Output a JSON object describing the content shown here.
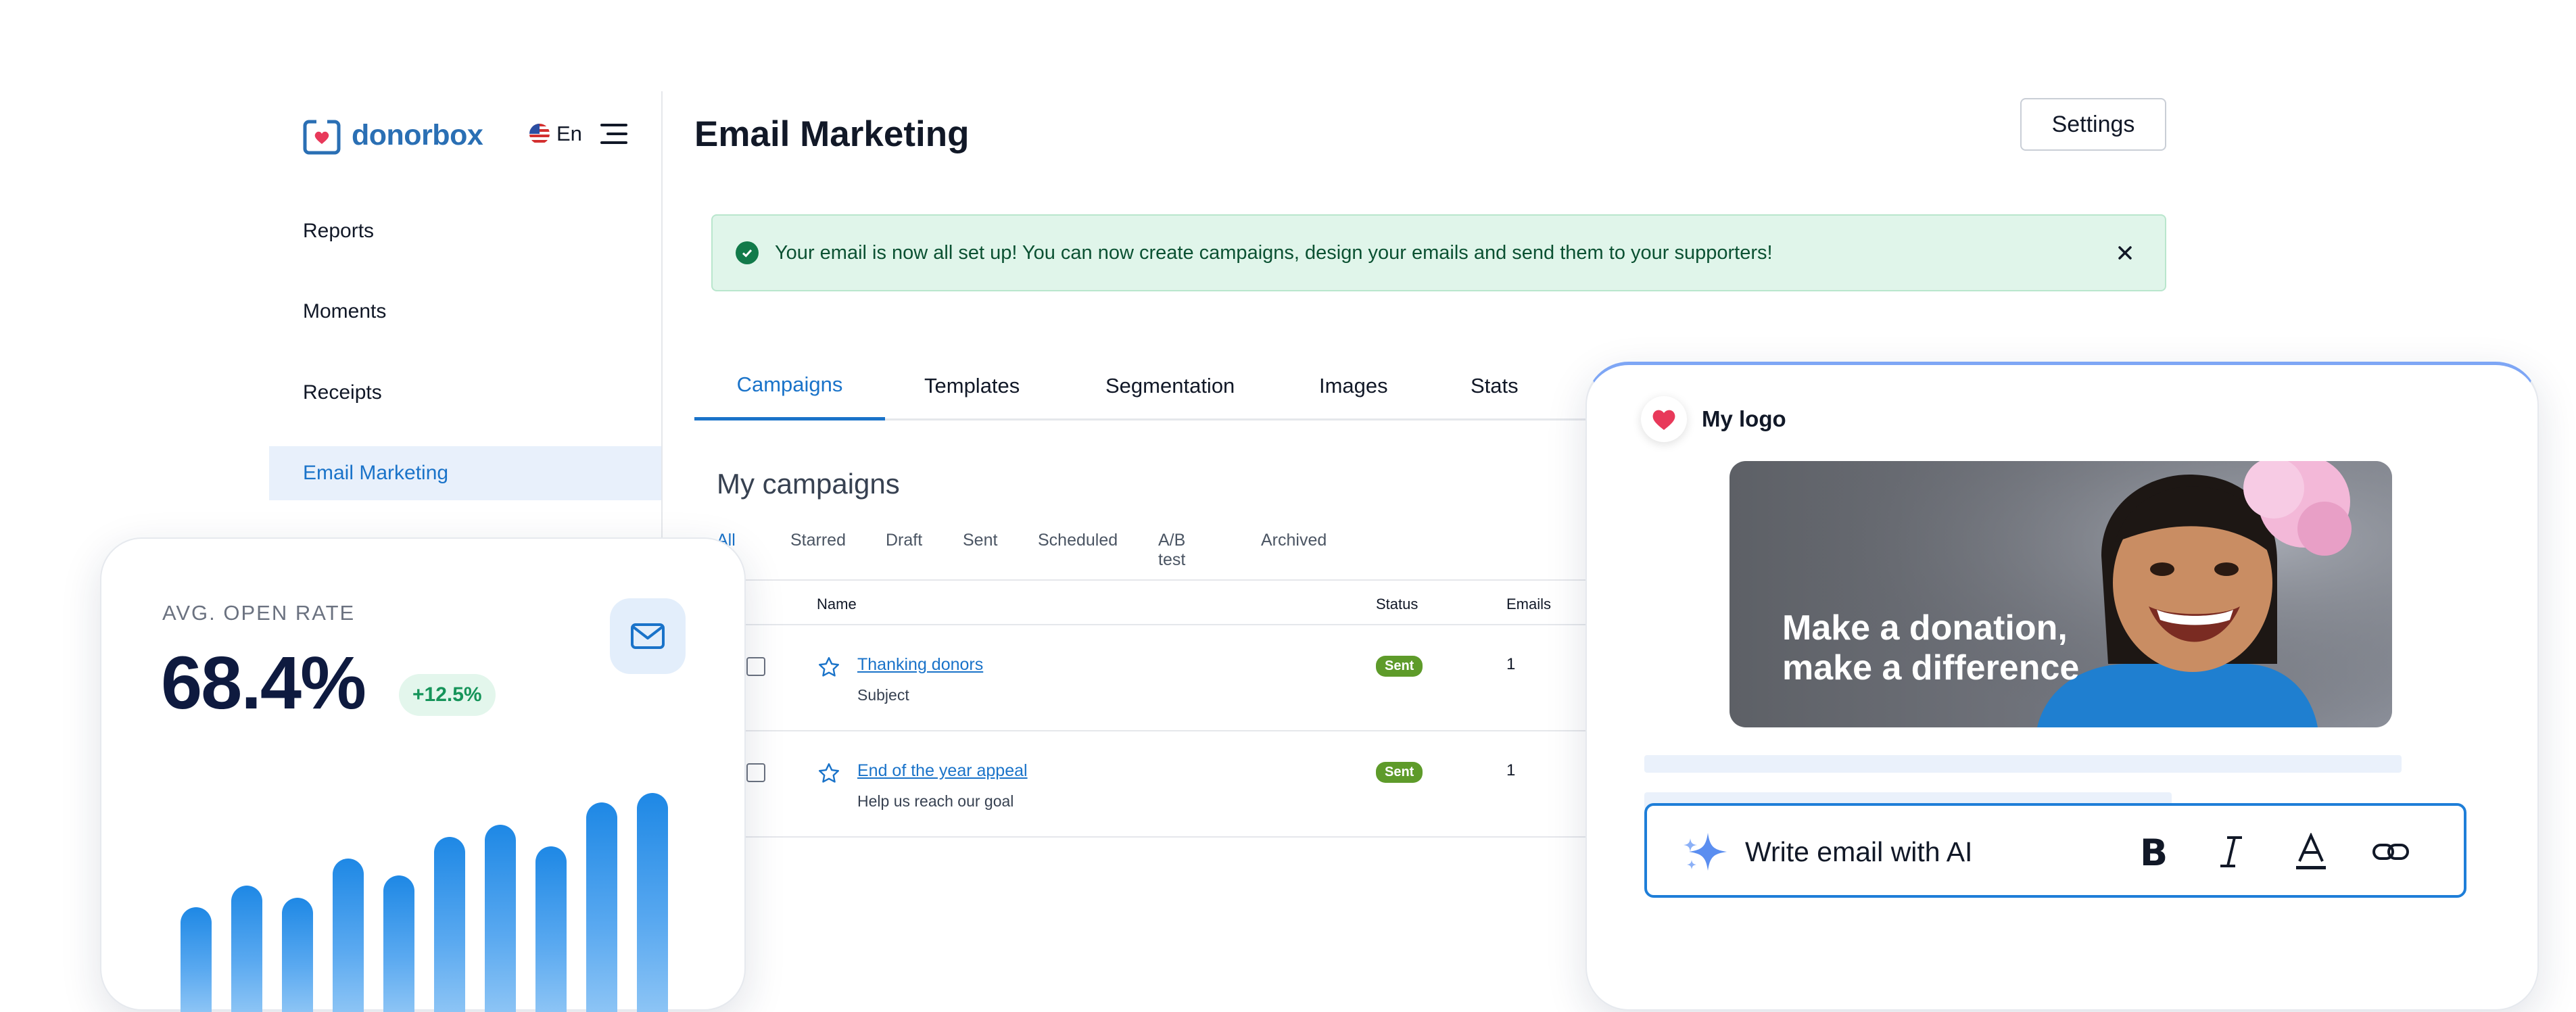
{
  "brand": {
    "name": "donorbox",
    "color": "#2a6fb4"
  },
  "language": {
    "label": "En"
  },
  "sidebar": {
    "items": [
      {
        "label": "Reports",
        "active": false
      },
      {
        "label": "Moments",
        "active": false
      },
      {
        "label": "Receipts",
        "active": false
      },
      {
        "label": "Email Marketing",
        "active": true
      }
    ]
  },
  "header": {
    "title": "Email Marketing",
    "settings_label": "Settings"
  },
  "alert": {
    "text": "Your email is now all set up! You can now create campaigns, design your emails and send them to your supporters!"
  },
  "tabs": [
    {
      "label": "Campaigns",
      "active": true
    },
    {
      "label": "Templates"
    },
    {
      "label": "Segmentation"
    },
    {
      "label": "Images"
    },
    {
      "label": "Stats"
    }
  ],
  "campaigns": {
    "title": "My campaigns",
    "filters": [
      {
        "label": "All",
        "active": true
      },
      {
        "label": "Starred"
      },
      {
        "label": "Draft"
      },
      {
        "label": "Sent"
      },
      {
        "label": "Scheduled"
      },
      {
        "label": "A/B test"
      },
      {
        "label": "Archived"
      }
    ],
    "columns": {
      "name": "Name",
      "status": "Status",
      "emails": "Emails"
    },
    "rows": [
      {
        "name": "Thanking donors",
        "subtitle": "Subject",
        "status": "Sent",
        "emails": "1"
      },
      {
        "name": "End of the year appeal",
        "subtitle": "Help us reach our goal",
        "status": "Sent",
        "emails": "1"
      }
    ]
  },
  "open_rate": {
    "label": "AVG. OPEN RATE",
    "value": "68.4%",
    "delta": "+12.5%",
    "bar_levels": [
      0.43,
      0.52,
      0.47,
      0.63,
      0.56,
      0.72,
      0.77,
      0.68,
      0.86,
      0.9
    ]
  },
  "editor": {
    "logo_label": "My logo",
    "hero_text_line1": "Make a donation,",
    "hero_text_line2": "make a difference",
    "ai_label": "Write email with AI",
    "format_icons": [
      "bold-icon",
      "italic-icon",
      "text-color-icon",
      "link-icon"
    ]
  },
  "colors": {
    "accent": "#1a73c9",
    "success_bg": "#e0f5ea",
    "badge": "#5e9b2a",
    "heart": "#e8395a"
  }
}
